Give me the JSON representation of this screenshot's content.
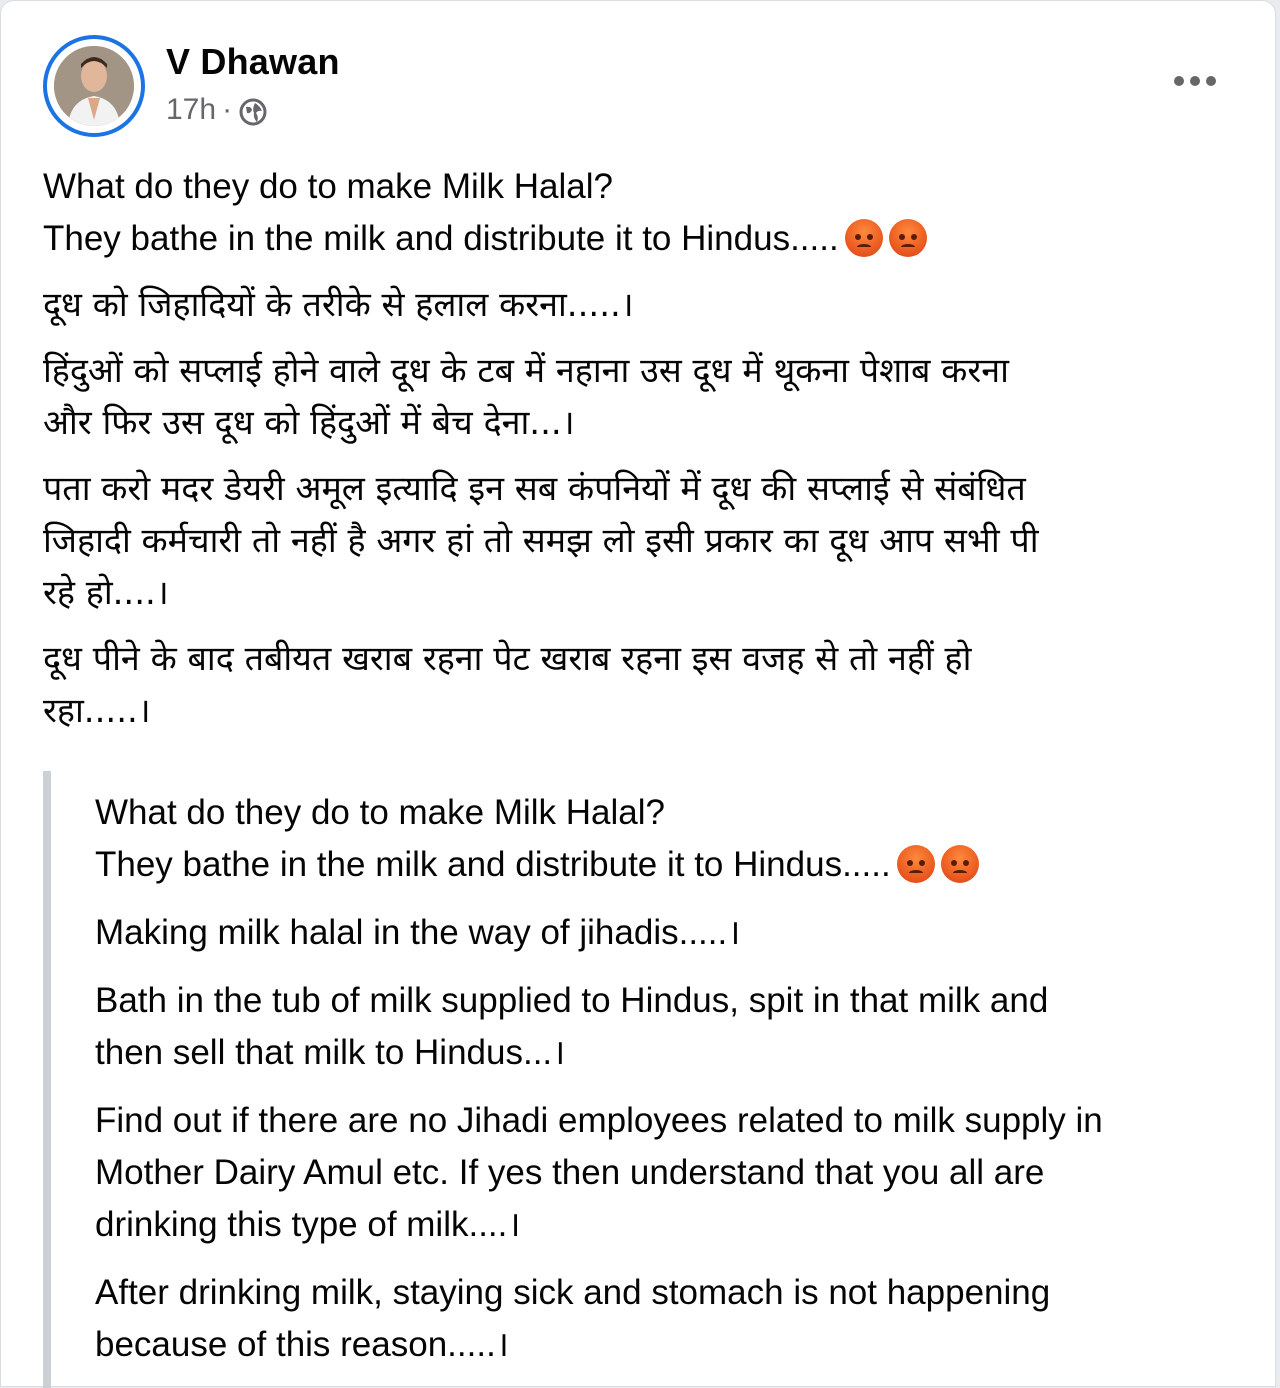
{
  "post": {
    "author": "V Dhawan",
    "time": "17h",
    "separator": "·",
    "privacy_icon": "globe-icon",
    "more_icon": "more-horizontal-icon",
    "body": {
      "p1_line1": "What do they do to make Milk Halal?",
      "p1_line2": "They bathe in the milk and distribute it to Hindus.....",
      "p2": "दूध को जिहादियों के तरीके से हलाल करना.....।",
      "p3_line1": "हिंदुओं को सप्लाई होने वाले दूध के टब में नहाना उस दूध में थूकना पेशाब करना",
      "p3_line2": "और फिर उस दूध को हिंदुओं में बेच देना...।",
      "p4_line1": "पता करो मदर डेयरी अमूल इत्यादि इन सब कंपनियों में दूध की सप्लाई से संबंधित",
      "p4_line2": "जिहादी कर्मचारी तो नहीं है अगर हां तो समझ लो इसी प्रकार का दूध आप सभी पी",
      "p4_line3": "रहे हो....।",
      "p5_line1": "दूध पीने के बाद तबीयत खराब रहना पेट खराब रहना इस वजह से तो नहीं हो",
      "p5_line2": "रहा.....।"
    },
    "translation": {
      "p1_line1": "What do they do to make Milk Halal?",
      "p1_line2": "They bathe in the milk and distribute it to Hindus.....",
      "p2": "Making milk halal in the way of jihadis.....।",
      "p3_line1": "Bath in the tub of milk supplied to Hindus, spit in that milk and",
      "p3_line2": "then sell that milk to Hindus...।",
      "p4_line1": "Find out if there are no Jihadi employees related to milk supply in",
      "p4_line2": "Mother Dairy Amul etc. If yes then understand that you all are",
      "p4_line3": "drinking this type of milk....।",
      "p5_line1": "After drinking milk, staying sick and stomach is not happening",
      "p5_line2": "because of this reason.....।"
    },
    "emoji": "angry-face-icon",
    "colors": {
      "avatar_ring": "#1b74e4",
      "meta_text": "#65676b",
      "quote_bar": "#ccd0d5"
    }
  }
}
